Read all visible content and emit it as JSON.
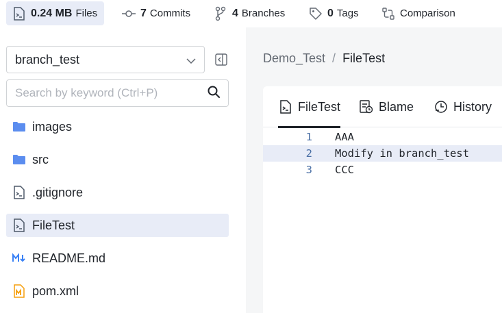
{
  "stats": {
    "files": {
      "num": "0.24 MB",
      "label": "Files"
    },
    "commits": {
      "num": "7",
      "label": "Commits"
    },
    "branches": {
      "num": "4",
      "label": "Branches"
    },
    "tags": {
      "num": "0",
      "label": "Tags"
    },
    "comparison": {
      "label": "Comparison"
    }
  },
  "sidebar": {
    "branch": "branch_test",
    "search_placeholder": "Search by keyword (Ctrl+P)",
    "files": [
      {
        "name": "images",
        "icon": "folder-icon"
      },
      {
        "name": "src",
        "icon": "folder-icon"
      },
      {
        "name": ".gitignore",
        "icon": "file-code-icon"
      },
      {
        "name": "FileTest",
        "icon": "file-code-icon",
        "selected": true
      },
      {
        "name": "README.md",
        "icon": "markdown-icon"
      },
      {
        "name": "pom.xml",
        "icon": "maven-icon"
      }
    ]
  },
  "breadcrumb": {
    "repo": "Demo_Test",
    "sep": "/",
    "file": "FileTest"
  },
  "tabs": [
    {
      "label": "FileTest",
      "icon": "file-code-icon",
      "active": true
    },
    {
      "label": "Blame",
      "icon": "blame-icon"
    },
    {
      "label": "History",
      "icon": "history-icon"
    }
  ],
  "code": [
    {
      "no": "1",
      "text": "AAA"
    },
    {
      "no": "2",
      "text": "Modify in branch_test"
    },
    {
      "no": "3",
      "text": "CCC"
    }
  ],
  "colors": {
    "accent_bg": "#e8ecf7",
    "folder": "#5b8def",
    "markdown": "#3b82f6",
    "maven": "#f59e0b"
  }
}
